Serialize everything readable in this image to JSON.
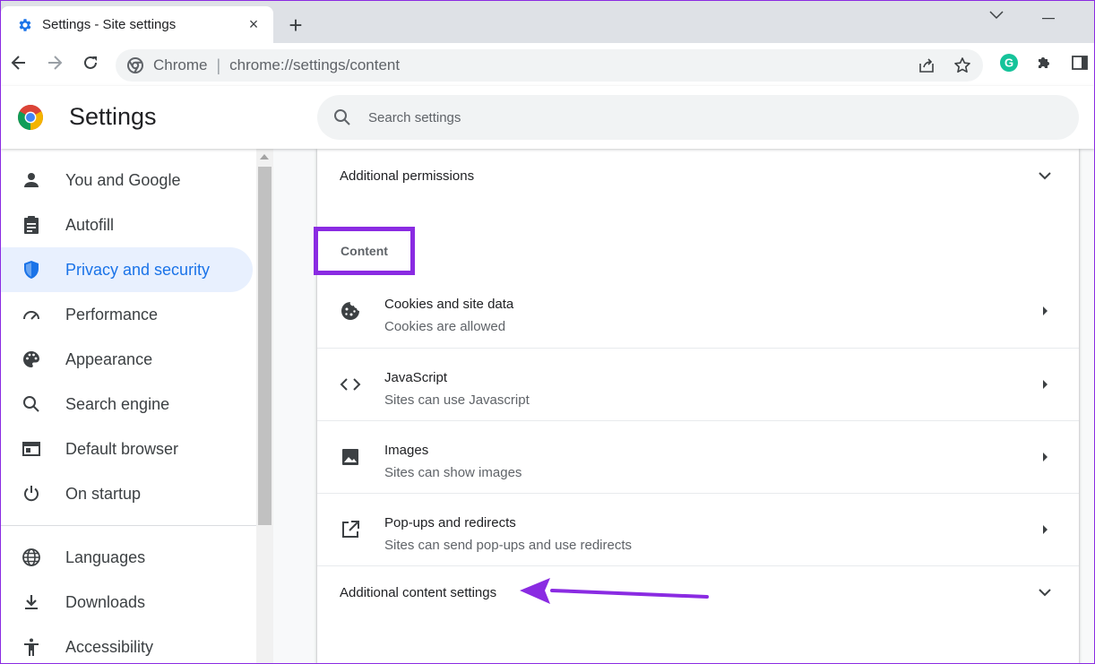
{
  "tab": {
    "title": "Settings - Site settings",
    "close_label": "×",
    "new_tab_label": "+"
  },
  "toolbar": {
    "scheme_label": "Chrome",
    "separator": "|",
    "url": "chrome://settings/content",
    "profile_initial": "G"
  },
  "header": {
    "title": "Settings",
    "search_placeholder": "Search settings"
  },
  "sidebar": {
    "items": [
      {
        "label": "You and Google",
        "icon": "person-icon"
      },
      {
        "label": "Autofill",
        "icon": "clipboard-icon"
      },
      {
        "label": "Privacy and security",
        "icon": "shield-icon",
        "active": true
      },
      {
        "label": "Performance",
        "icon": "speedometer-icon"
      },
      {
        "label": "Appearance",
        "icon": "palette-icon"
      },
      {
        "label": "Search engine",
        "icon": "search-icon"
      },
      {
        "label": "Default browser",
        "icon": "browser-window-icon"
      },
      {
        "label": "On startup",
        "icon": "power-icon"
      },
      {
        "label": "Languages",
        "icon": "globe-icon"
      },
      {
        "label": "Downloads",
        "icon": "download-icon"
      },
      {
        "label": "Accessibility",
        "icon": "accessibility-icon"
      }
    ]
  },
  "content": {
    "additional_permissions": "Additional permissions",
    "section_title": "Content",
    "items": [
      {
        "title": "Cookies and site data",
        "subtitle": "Cookies are allowed",
        "icon": "cookie-icon"
      },
      {
        "title": "JavaScript",
        "subtitle": "Sites can use Javascript",
        "icon": "code-icon"
      },
      {
        "title": "Images",
        "subtitle": "Sites can show images",
        "icon": "image-icon"
      },
      {
        "title": "Pop-ups and redirects",
        "subtitle": "Sites can send pop-ups and use redirects",
        "icon": "open-in-new-icon"
      }
    ],
    "additional_content_settings": "Additional content settings"
  },
  "colors": {
    "accent": "#1a73e8",
    "annotation": "#8a2be2",
    "active_bg": "#e8f0fe",
    "grammarly": "#15c39a"
  }
}
